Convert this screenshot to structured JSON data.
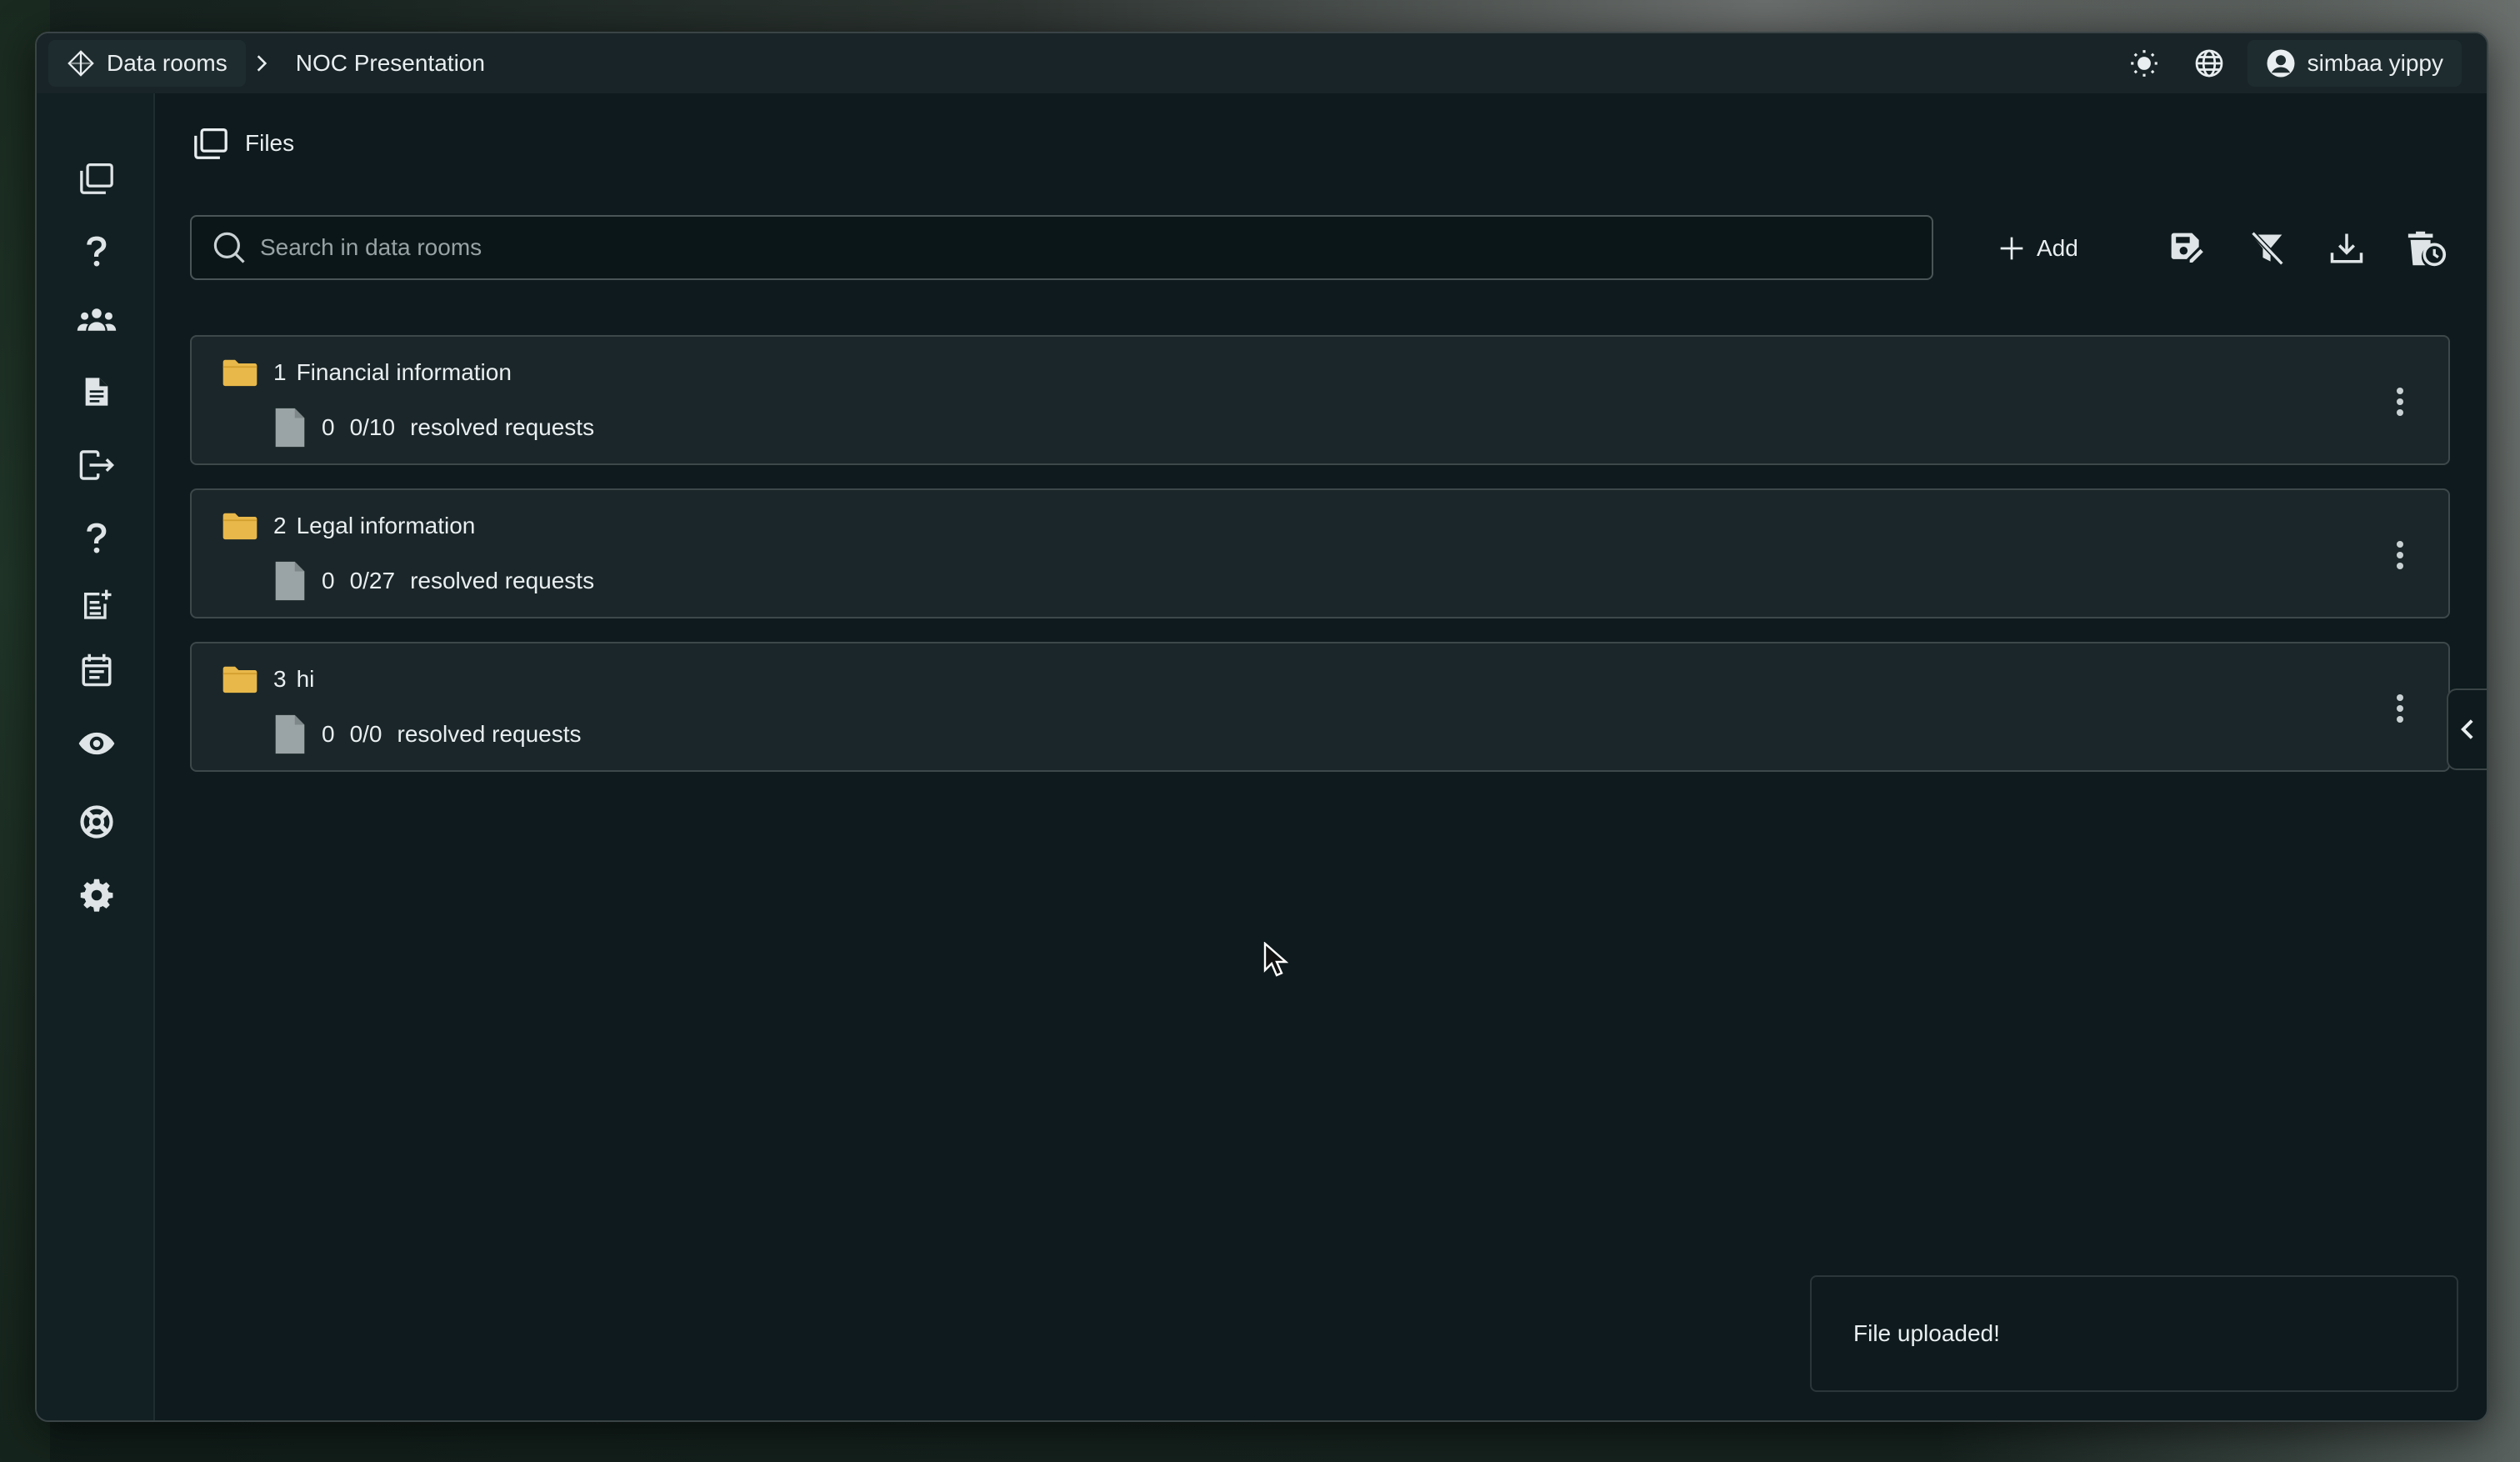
{
  "breadcrumb": {
    "root": "Data rooms",
    "current": "NOC Presentation"
  },
  "user": {
    "name": "simbaa yippy"
  },
  "page": {
    "title": "Files"
  },
  "search": {
    "placeholder": "Search in data rooms"
  },
  "toolbar": {
    "add_label": "Add"
  },
  "rooms": [
    {
      "index": "1",
      "name": "Financial information",
      "files": "0",
      "progress": "0/10",
      "status": "resolved requests"
    },
    {
      "index": "2",
      "name": "Legal information",
      "files": "0",
      "progress": "0/27",
      "status": "resolved requests"
    },
    {
      "index": "3",
      "name": "hi",
      "files": "0",
      "progress": "0/0",
      "status": "resolved requests"
    }
  ],
  "toast": {
    "message": "File uploaded!"
  },
  "colors": {
    "folder": "#e8b84a",
    "file": "#9aa3a6",
    "window_bg": "#0e1a1d",
    "card_bg": "#1a2629"
  },
  "icons": [
    "data-rooms-icon",
    "sun-icon",
    "globe-icon",
    "user-circle-icon",
    "files-icon",
    "question-icon",
    "users-icon",
    "document-icon",
    "export-icon",
    "request-add-icon",
    "calendar-icon",
    "eye-icon",
    "lifebuoy-icon",
    "gear-icon",
    "plus-icon",
    "save-edit-icon",
    "clear-filter-icon",
    "download-icon",
    "trash-clock-icon",
    "folder-icon",
    "file-icon",
    "kebab-icon",
    "chevron-left-icon"
  ]
}
